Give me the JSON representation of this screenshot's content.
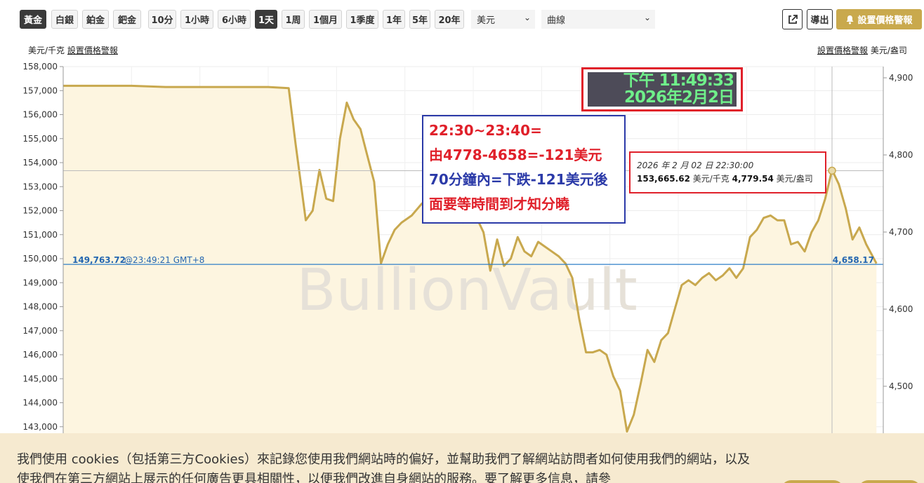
{
  "toolbar": {
    "metals": [
      "黃金",
      "白銀",
      "鉑金",
      "鈀金"
    ],
    "active_metal": "黃金",
    "periods": [
      "10分",
      "1小時",
      "6小時",
      "1天",
      "1周",
      "1個月",
      "1季度",
      "1年",
      "5年",
      "20年"
    ],
    "active_period": "1天",
    "currency_select": "美元",
    "chart_type_select": "曲線",
    "export_label": "導出",
    "alert_label": "設置價格警報"
  },
  "units": {
    "left": "美元/千克",
    "left_link": "設置價格警報",
    "right_link": "設置價格警報",
    "right": "美元/盎司"
  },
  "chart_data": {
    "type": "area",
    "watermark": "BullionVault",
    "left_ticks": [
      "158,000",
      "157,000",
      "156,000",
      "155,000",
      "154,000",
      "153,000",
      "152,000",
      "151,000",
      "150,000",
      "149,000",
      "148,000",
      "147,000",
      "146,000",
      "145,000",
      "144,000",
      "143,000"
    ],
    "right_ticks": [
      "4,900",
      "4,800",
      "4,700",
      "4,600",
      "4,500"
    ],
    "ylim_left": [
      142700,
      158000
    ],
    "xlim_hours": [
      0,
      24
    ],
    "current_left_label": "149,763.72",
    "current_time_label": "@23:49:21 GMT+8",
    "current_right_label": "4,658.17",
    "current_value_left": 149763.72,
    "hover_value_left": 153665.62,
    "hover_time_hours": 22.5,
    "colors": {
      "line": "#c8a84e",
      "fill": "#fdf5e0",
      "current_line": "#2f7fc8",
      "current_text": "#2466b0"
    },
    "series": [
      {
        "x": [
          0,
          2,
          3,
          6,
          6.6,
          6.8,
          7.1,
          7.3,
          7.5,
          7.7,
          7.9,
          8.1,
          8.3,
          8.5,
          8.7,
          8.9,
          9.1,
          9.3,
          9.5,
          9.7,
          9.9,
          10.2,
          10.5,
          10.7,
          10.9,
          11.1,
          11.3,
          11.5,
          11.7,
          11.9,
          12.1,
          12.3,
          12.5,
          12.7,
          12.9,
          13.1,
          13.3,
          13.5,
          13.7,
          13.9,
          14.1,
          14.3,
          14.5,
          14.7,
          14.9,
          15.1,
          15.3,
          15.5,
          15.7,
          15.9,
          16.1,
          16.3,
          16.5,
          16.7,
          16.9,
          17.1,
          17.3,
          17.5,
          17.7,
          17.9,
          18.1,
          18.3,
          18.5,
          18.7,
          18.9,
          19.1,
          19.3,
          19.5,
          19.7,
          19.9,
          20.1,
          20.3,
          20.5,
          20.7,
          20.9,
          21.1,
          21.3,
          21.5,
          21.7,
          21.9,
          22.1,
          22.3,
          22.5,
          22.7,
          22.9,
          23.1,
          23.3,
          23.5,
          23.8
        ],
        "values": [
          157200,
          157200,
          157150,
          157150,
          157100,
          154800,
          151600,
          152000,
          153700,
          152500,
          152400,
          155000,
          156500,
          155800,
          155400,
          154300,
          153200,
          149800,
          150600,
          151200,
          151500,
          151800,
          152300,
          151900,
          152200,
          152300,
          152600,
          151900,
          151500,
          151600,
          151700,
          151100,
          149500,
          150800,
          149700,
          150000,
          150900,
          150300,
          150100,
          150700,
          150500,
          150300,
          150100,
          149800,
          149200,
          147500,
          146100,
          146100,
          146200,
          146000,
          145100,
          144500,
          142800,
          143500,
          144800,
          146200,
          145700,
          146600,
          146900,
          147900,
          148900,
          149100,
          148900,
          149200,
          149400,
          149100,
          149300,
          149600,
          149200,
          149600,
          150900,
          151200,
          151700,
          151800,
          151600,
          151600,
          150600,
          150700,
          150300,
          151100,
          151600,
          152500,
          153700,
          153100,
          152100,
          150800,
          151300,
          150600,
          149800
        ]
      }
    ]
  },
  "time_overlay": {
    "line1": "下午 11:49:33",
    "line2": "2026年2月2日"
  },
  "note": {
    "line1": "22:30~23:40=",
    "line2": "由4778-4658=-121美元",
    "line3": "70分鐘內=下跌-121美元後",
    "line4": "面要等時間到才知分曉"
  },
  "tooltip": {
    "date": "2026 年 2 月 02 日 22:30:00",
    "left_value": "153,665.62",
    "left_unit": "美元/千克",
    "right_value": "4,779.54",
    "right_unit": "美元/盎司"
  },
  "cookie": {
    "text": "我們使用 cookies（包括第三方Cookies）來記錄您使用我們網站時的偏好，並幫助我們了解網站訪問者如何使用我們的網站，以及使我們在第三方網站上展示的任何廣告更具相關性，以便我們改進自身網站的服務。要了解更多信息，請參"
  }
}
